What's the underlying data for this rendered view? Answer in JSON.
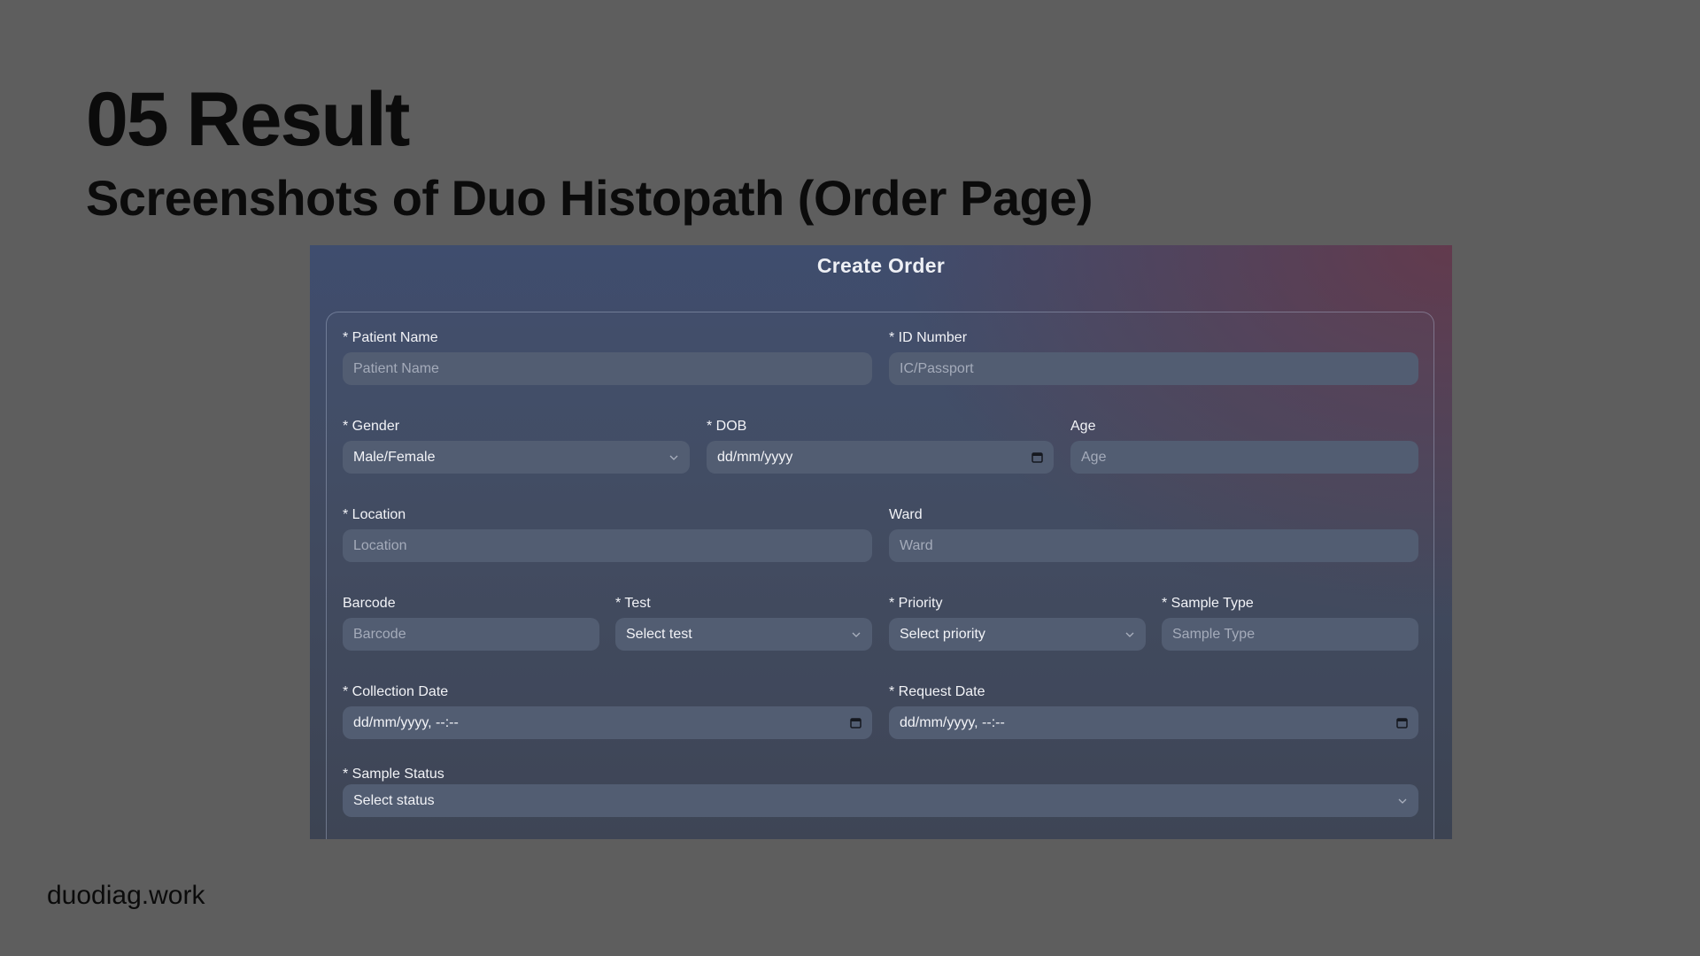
{
  "slide": {
    "title": "05 Result",
    "subtitle": "Screenshots of Duo Histopath (Order Page)",
    "footer": "duodiag.work"
  },
  "form": {
    "heading": "Create Order",
    "patient_name": {
      "label": "* Patient Name",
      "placeholder": "Patient Name"
    },
    "id_number": {
      "label": "* ID Number",
      "placeholder": "IC/Passport"
    },
    "gender": {
      "label": "* Gender",
      "value": "Male/Female"
    },
    "dob": {
      "label": "* DOB",
      "value": "dd/mm/yyyy"
    },
    "age": {
      "label": "Age",
      "placeholder": "Age"
    },
    "location": {
      "label": "* Location",
      "placeholder": "Location"
    },
    "ward": {
      "label": "Ward",
      "placeholder": "Ward"
    },
    "barcode": {
      "label": "Barcode",
      "placeholder": "Barcode"
    },
    "test": {
      "label": "* Test",
      "value": "Select test"
    },
    "priority": {
      "label": "* Priority",
      "value": "Select priority"
    },
    "sample_type": {
      "label": "* Sample Type",
      "placeholder": "Sample Type"
    },
    "collection_date": {
      "label": "* Collection Date",
      "value": "dd/mm/yyyy, --:--"
    },
    "request_date": {
      "label": "* Request Date",
      "value": "dd/mm/yyyy, --:--"
    },
    "sample_status": {
      "label": "* Sample Status",
      "value": "Select status"
    }
  },
  "colors": {
    "slide_background": "#5e5e5e",
    "input_background": "#525d72",
    "label_text": "#f2f3f7",
    "placeholder_text": "#a4abba"
  },
  "icons": {
    "select": "chevron-down-icon",
    "date": "calendar-icon"
  }
}
